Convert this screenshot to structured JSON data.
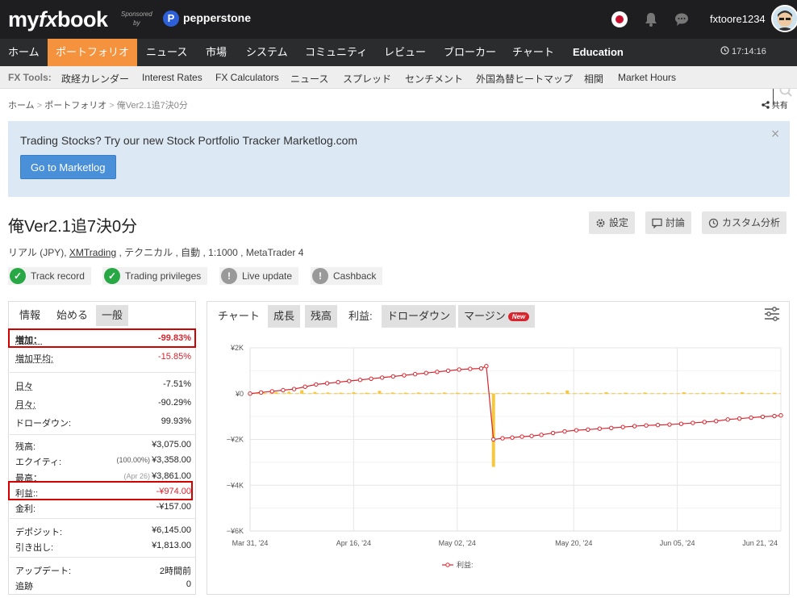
{
  "header": {
    "logo_left": "my",
    "logo_fx": "fx",
    "logo_right": "book",
    "sponsored_line1": "Sponsored",
    "sponsored_line2": "by",
    "sponsor_name": "pepperstone",
    "username": "fxtoore1234"
  },
  "nav": {
    "items": [
      "ホーム",
      "ポートフォリオ",
      "ニュース",
      "市場",
      "システム",
      "コミュニティ",
      "レビュー",
      "ブローカー",
      "チャート",
      "Education"
    ],
    "active_index": 1,
    "clock": "17:14:16"
  },
  "tools": {
    "label": "FX Tools:",
    "items": [
      "政経カレンダー",
      "Interest Rates",
      "FX Calculators",
      "ニュース",
      "スプレッド",
      "センチメント",
      "外国為替ヒートマップ",
      "相関",
      "Market Hours"
    ]
  },
  "breadcrumb": {
    "home": "ホーム",
    "sep": ">",
    "portfolio": "ポートフォリオ",
    "current": "俺Ver2.1追7決0分"
  },
  "share_label": "共有",
  "banner": {
    "text": "Trading Stocks? Try our new Stock Portfolio Tracker Marketlog.com",
    "button": "Go to Marketlog",
    "close": "×"
  },
  "account": {
    "title": "俺Ver2.1追7決0分",
    "info_pre": "リアル (JPY), ",
    "broker": "XMTrading",
    "info_post": " , テクニカル , 自動 , 1:1000 , MetaTrader 4",
    "actions": [
      "設定",
      "討論",
      "カスタム分析"
    ],
    "badges": [
      {
        "label": "Track record",
        "state": "ok"
      },
      {
        "label": "Trading privileges",
        "state": "ok"
      },
      {
        "label": "Live update",
        "state": "info"
      },
      {
        "label": "Cashback",
        "state": "info"
      }
    ]
  },
  "stats": {
    "tabs": [
      "情報",
      "始める",
      "一般"
    ],
    "rows": [
      {
        "k": "増加：",
        "v": "-99.83%",
        "red": true
      },
      {
        "k": "増加平均:",
        "v": "-15.85%",
        "red": true
      },
      {
        "k": "日々",
        "v": "-7.51%"
      },
      {
        "k": "月々:",
        "v": "-90.29%"
      },
      {
        "k": "ドローダウン:",
        "v": "99.93%"
      },
      {
        "k": "残高:",
        "v": "¥3,075.00"
      },
      {
        "k": "エクイティ:",
        "pre": "(100.00%)",
        "v": "¥3,358.00"
      },
      {
        "k": "最高：",
        "pre": "(Apr 26)",
        "v": "¥3,861.00"
      },
      {
        "k": "利益::",
        "v": "-¥974.00",
        "red": true
      },
      {
        "k": "金利:",
        "v": "-¥157.00"
      },
      {
        "k": "デポジット:",
        "v": "¥6,145.00"
      },
      {
        "k": "引き出し:",
        "v": "¥1,813.00"
      },
      {
        "k": "アップデート:",
        "v": "2時間前"
      },
      {
        "k": "追跡",
        "v": "0"
      }
    ]
  },
  "chart_tabs": [
    "チャート",
    "成長",
    "残高",
    "利益:",
    "ドローダウン",
    "マージン"
  ],
  "chart_active_tab": 3,
  "new_badge": "New",
  "chart_data": {
    "type": "line",
    "y_tick_labels": [
      "¥2K",
      "¥0",
      "−¥2K",
      "−¥4K",
      "−¥6K"
    ],
    "y_ticks": [
      2000,
      0,
      -2000,
      -4000,
      -6000
    ],
    "ylim": [
      -6000,
      2000
    ],
    "x_tick_labels": [
      "Mar 31, '24",
      "Apr 16, '24",
      "May 02, '24",
      "May 20, '24",
      "Jun 05, '24",
      "Jun 21, '24"
    ],
    "x_ticks": [
      0,
      16,
      32,
      50,
      66,
      82
    ],
    "xlim": [
      0,
      82
    ],
    "legend": "利益:",
    "series": [
      {
        "name": "利益:",
        "color": "#d9232d",
        "points": [
          [
            0,
            0
          ],
          [
            1.7,
            50
          ],
          [
            3.4,
            100
          ],
          [
            5.1,
            150
          ],
          [
            6.8,
            200
          ],
          [
            8.5,
            300
          ],
          [
            10.2,
            400
          ],
          [
            11.9,
            450
          ],
          [
            13.6,
            500
          ],
          [
            15.3,
            550
          ],
          [
            17.0,
            600
          ],
          [
            18.7,
            650
          ],
          [
            20.4,
            700
          ],
          [
            22.1,
            750
          ],
          [
            23.8,
            800
          ],
          [
            25.5,
            850
          ],
          [
            27.2,
            900
          ],
          [
            28.9,
            950
          ],
          [
            30.6,
            1000
          ],
          [
            32.3,
            1050
          ],
          [
            34.0,
            1080
          ],
          [
            35.7,
            1100
          ],
          [
            36.5,
            1200
          ],
          [
            37.6,
            -2000
          ],
          [
            39.0,
            -1950
          ],
          [
            40.5,
            -1920
          ],
          [
            42.0,
            -1880
          ],
          [
            43.5,
            -1850
          ],
          [
            45.0,
            -1800
          ],
          [
            46.8,
            -1720
          ],
          [
            48.6,
            -1650
          ],
          [
            50.4,
            -1600
          ],
          [
            52.2,
            -1570
          ],
          [
            54.0,
            -1530
          ],
          [
            55.8,
            -1500
          ],
          [
            57.6,
            -1460
          ],
          [
            59.4,
            -1420
          ],
          [
            61.2,
            -1390
          ],
          [
            63.0,
            -1370
          ],
          [
            64.8,
            -1350
          ],
          [
            66.6,
            -1320
          ],
          [
            68.4,
            -1280
          ],
          [
            70.2,
            -1240
          ],
          [
            72.0,
            -1200
          ],
          [
            73.8,
            -1130
          ],
          [
            75.6,
            -1090
          ],
          [
            77.4,
            -1050
          ],
          [
            79.2,
            -1010
          ],
          [
            81.0,
            -980
          ],
          [
            82.0,
            -950
          ]
        ]
      }
    ],
    "bars": {
      "color": "#f5c842",
      "points": [
        [
          2,
          40
        ],
        [
          4,
          60
        ],
        [
          6,
          80
        ],
        [
          8,
          150
        ],
        [
          10,
          70
        ],
        [
          12,
          50
        ],
        [
          14,
          40
        ],
        [
          16,
          60
        ],
        [
          18,
          40
        ],
        [
          20,
          120
        ],
        [
          22,
          50
        ],
        [
          24,
          40
        ],
        [
          26,
          50
        ],
        [
          28,
          40
        ],
        [
          30,
          50
        ],
        [
          32,
          40
        ],
        [
          34,
          30
        ],
        [
          37.6,
          -3200
        ],
        [
          40,
          40
        ],
        [
          43,
          30
        ],
        [
          46,
          50
        ],
        [
          49,
          140
        ],
        [
          52,
          40
        ],
        [
          55,
          60
        ],
        [
          58,
          40
        ],
        [
          61,
          50
        ],
        [
          64,
          30
        ],
        [
          67,
          60
        ],
        [
          70,
          40
        ],
        [
          73,
          50
        ],
        [
          76,
          60
        ],
        [
          79,
          40
        ],
        [
          81,
          40
        ]
      ]
    },
    "grid": true
  }
}
